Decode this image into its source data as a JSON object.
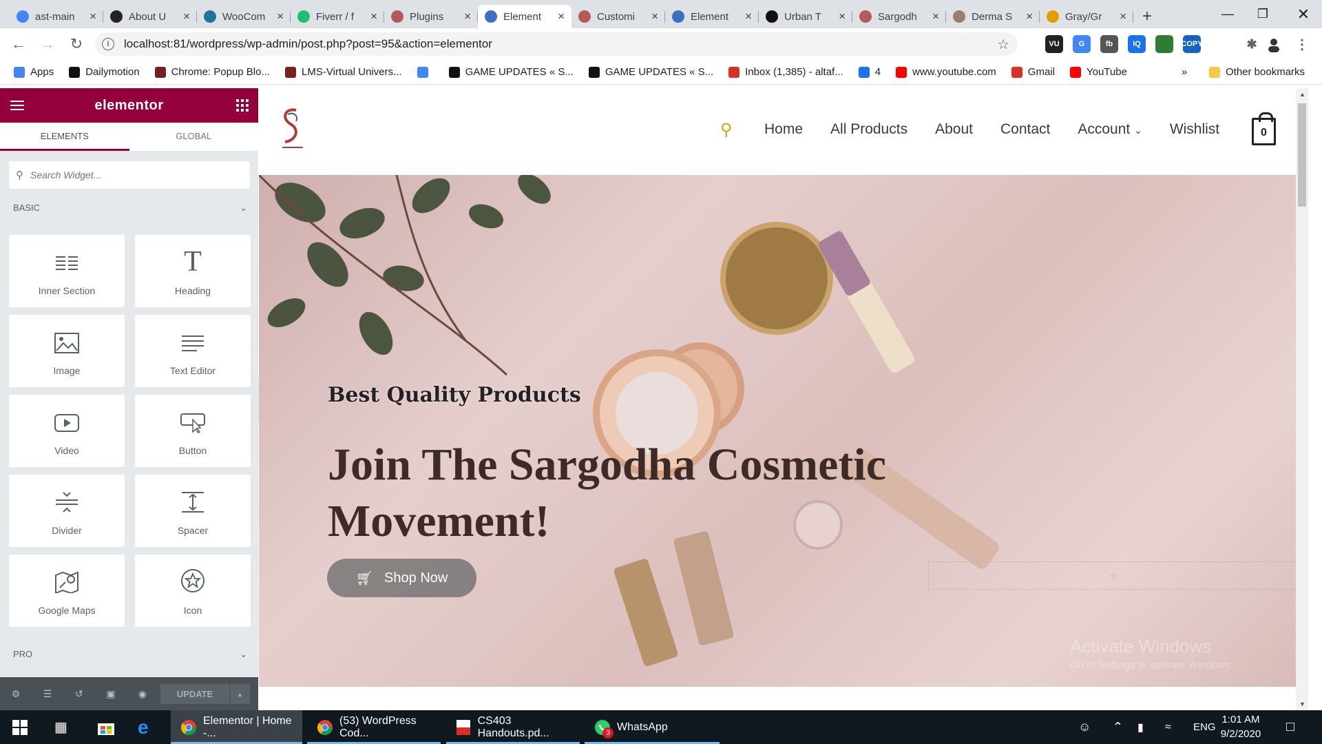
{
  "browser": {
    "tabs": [
      {
        "label": "ast-main",
        "icon": "google-icon",
        "color": "#4285f4"
      },
      {
        "label": "About U",
        "icon": "site-icon",
        "color": "#222222"
      },
      {
        "label": "WooCom",
        "icon": "wordpress-icon",
        "color": "#21759b"
      },
      {
        "label": "Fiverr / f",
        "icon": "fiverr-icon",
        "color": "#1dbf73"
      },
      {
        "label": "Plugins",
        "icon": "sargodha-icon",
        "color": "#b55a5a"
      },
      {
        "label": "Element",
        "icon": "elementor-icon",
        "color": "#3c6fbf"
      },
      {
        "label": "Customi",
        "icon": "sargodha-icon",
        "color": "#b55a5a"
      },
      {
        "label": "Element",
        "icon": "elementor-icon",
        "color": "#3c6fbf"
      },
      {
        "label": "Urban T",
        "icon": "urban-icon",
        "color": "#111111"
      },
      {
        "label": "Sargodh",
        "icon": "sargodha-icon",
        "color": "#b55a5a"
      },
      {
        "label": "Derma S",
        "icon": "derma-icon",
        "color": "#a07a6a"
      },
      {
        "label": "Gray/Gr",
        "icon": "r-icon",
        "color": "#e0a100"
      }
    ],
    "active_tab": 5,
    "url": "localhost:81/wordpress/wp-admin/post.php?post=95&action=elementor",
    "extensions": [
      "VU",
      "G",
      "fb",
      "IQ",
      "",
      "COPY",
      "",
      "",
      ""
    ],
    "bookmarks": [
      {
        "label": "Apps",
        "icon": "apps-icon",
        "color": "#4285f4"
      },
      {
        "label": "Dailymotion",
        "icon": "dailymotion-icon",
        "color": "#111111"
      },
      {
        "label": "Chrome: Popup Blo...",
        "icon": "vu-icon",
        "color": "#7a1f1f"
      },
      {
        "label": "LMS-Virtual Univers...",
        "icon": "vu-icon",
        "color": "#7a1f1f"
      },
      {
        "label": "",
        "icon": "google-icon",
        "color": "#4285f4"
      },
      {
        "label": "GAME UPDATES « S...",
        "icon": "game-icon",
        "color": "#111111"
      },
      {
        "label": "GAME UPDATES « S...",
        "icon": "game-icon",
        "color": "#111111"
      },
      {
        "label": "Inbox (1,385) - altaf...",
        "icon": "gmail-icon",
        "color": "#d93025"
      },
      {
        "label": "4",
        "icon": "download-icon",
        "color": "#1a73e8"
      },
      {
        "label": "www.youtube.com",
        "icon": "youtube-icon",
        "color": "#ff0000"
      },
      {
        "label": "Gmail",
        "icon": "gmail-icon",
        "color": "#d93025"
      },
      {
        "label": "YouTube",
        "icon": "youtube-icon",
        "color": "#ff0000"
      }
    ],
    "more": "»",
    "other_bookmarks": "Other bookmarks"
  },
  "panel": {
    "logo": "elementor",
    "tabs": [
      "ELEMENTS",
      "GLOBAL"
    ],
    "search_placeholder": "Search Widget...",
    "basic_label": "BASIC",
    "pro_label": "PRO",
    "widgets": [
      {
        "label": "Inner Section",
        "icon": "inner-section-icon"
      },
      {
        "label": "Heading",
        "icon": "heading-icon"
      },
      {
        "label": "Image",
        "icon": "image-icon"
      },
      {
        "label": "Text Editor",
        "icon": "text-editor-icon"
      },
      {
        "label": "Video",
        "icon": "video-icon"
      },
      {
        "label": "Button",
        "icon": "button-icon"
      },
      {
        "label": "Divider",
        "icon": "divider-icon"
      },
      {
        "label": "Spacer",
        "icon": "spacer-icon"
      },
      {
        "label": "Google Maps",
        "icon": "google-maps-icon"
      },
      {
        "label": "Icon",
        "icon": "star-icon"
      }
    ],
    "update_label": "UPDATE",
    "accent": "#93003c"
  },
  "site": {
    "nav": [
      "Home",
      "All Products",
      "About",
      "Contact",
      "Account",
      "Wishlist"
    ],
    "cart_count": "0",
    "hero_tagline": "Best Quality Products",
    "hero_title": "Join The Sargodha Cosmetic Movement!",
    "hero_button": "Shop Now",
    "watermark_title": "Activate Windows",
    "watermark_sub": "Go to Settings to activate Windows."
  },
  "taskbar": {
    "apps": [
      {
        "label": "Elementor | Home -...",
        "icon": "chrome-icon"
      },
      {
        "label": "(53) WordPress Cod...",
        "icon": "chrome-icon"
      },
      {
        "label": "CS403 Handouts.pd...",
        "icon": "pdf-icon"
      },
      {
        "label": "WhatsApp",
        "icon": "whatsapp-icon",
        "badge": "3"
      }
    ],
    "language": "ENG",
    "time": "1:01 AM",
    "date": "9/2/2020"
  }
}
